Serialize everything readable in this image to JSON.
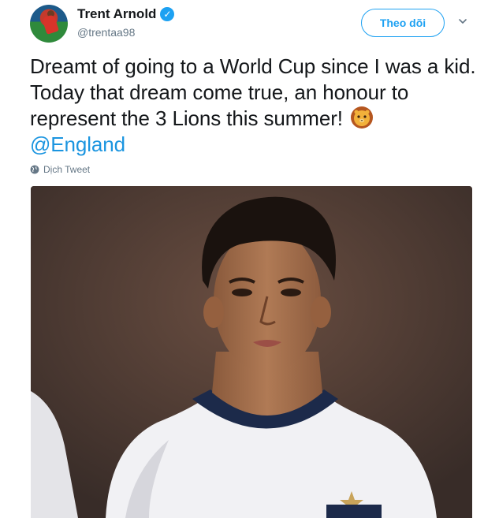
{
  "user": {
    "name": "Trent Arnold",
    "handle": "@trentaa98",
    "verified": true,
    "avatar_icon": "avatar"
  },
  "follow_button": {
    "label": "Theo dõi"
  },
  "menu_icon": "chevron-down-icon",
  "tweet": {
    "text": "Dreamt of going to a World Cup since I was a kid. Today that dream come true, an honour to represent the 3 Lions this summer!",
    "emoji": "lion-face",
    "mention": "@England"
  },
  "translate": {
    "label": "Dịch Tweet",
    "icon": "globe-icon"
  },
  "colors": {
    "accent": "#1da1f2",
    "mention": "#1b95e0",
    "muted": "#657786",
    "text": "#14171a"
  }
}
